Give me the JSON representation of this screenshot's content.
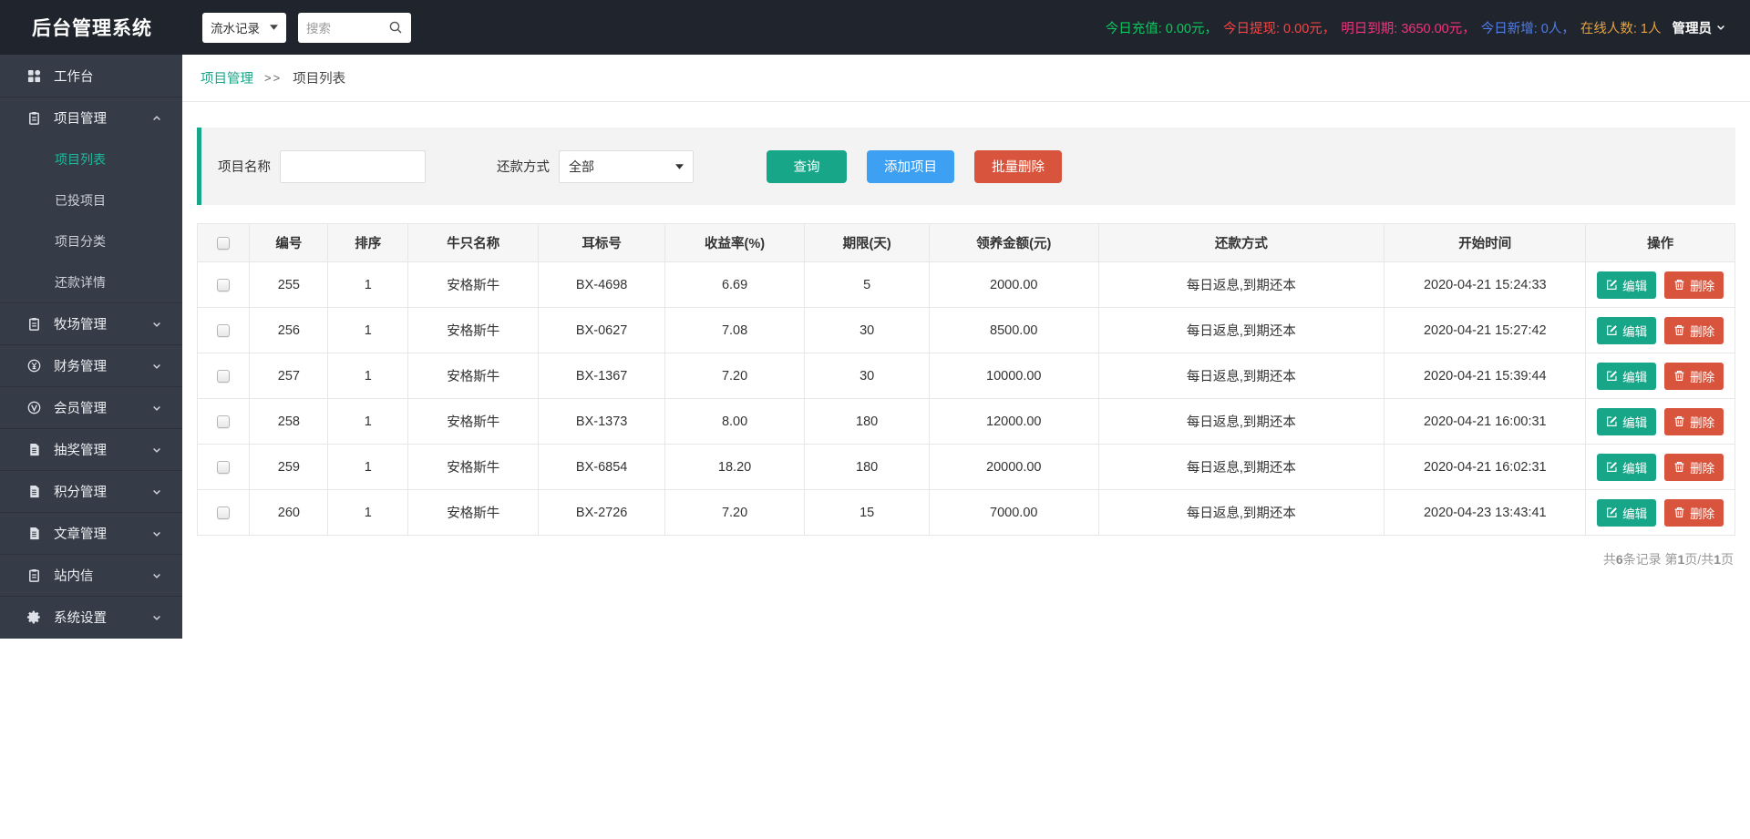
{
  "app": {
    "title": "后台管理系统"
  },
  "colors": {
    "accent_teal": "#18a689",
    "button_blue": "#3da0f2",
    "button_red": "#d9543c",
    "topbar_bg": "#20242d",
    "sidebar_bg": "#353b47",
    "active_menu": "#1abc9c"
  },
  "topbar": {
    "module_select": {
      "value": "流水记录"
    },
    "search": {
      "placeholder": "搜索"
    },
    "stats": [
      {
        "key": "recharge-today",
        "label": "今日充值:",
        "value": "0.00元",
        "sep": "，",
        "color": "#0bc860"
      },
      {
        "key": "withdraw-today",
        "label": "今日提现:",
        "value": "0.00元",
        "sep": "，",
        "color": "#f84343"
      },
      {
        "key": "due-tomorrow",
        "label": "明日到期:",
        "value": "3650.00元",
        "sep": "，",
        "color": "#f5317f"
      },
      {
        "key": "new-today",
        "label": "今日新增:",
        "value": "0人",
        "sep": "，",
        "color": "#4f7de9"
      },
      {
        "key": "online-count",
        "label": "在线人数:",
        "value": "1人",
        "sep": "",
        "color": "#e8a33d"
      }
    ],
    "user": {
      "name": "管理员"
    }
  },
  "sidebar": {
    "items": [
      {
        "label": "工作台",
        "icon": "grid-icon",
        "chevron": "",
        "children": []
      },
      {
        "label": "项目管理",
        "icon": "clipboard-icon",
        "chevron": "up",
        "children": [
          {
            "label": "项目列表",
            "active": true
          },
          {
            "label": "已投项目",
            "active": false
          },
          {
            "label": "项目分类",
            "active": false
          },
          {
            "label": "还款详情",
            "active": false
          }
        ]
      },
      {
        "label": "牧场管理",
        "icon": "clipboard-icon",
        "chevron": "down",
        "children": []
      },
      {
        "label": "财务管理",
        "icon": "yen-circle-icon",
        "chevron": "down",
        "children": []
      },
      {
        "label": "会员管理",
        "icon": "v-circle-icon",
        "chevron": "down",
        "children": []
      },
      {
        "label": "抽奖管理",
        "icon": "document-icon",
        "chevron": "down",
        "children": []
      },
      {
        "label": "积分管理",
        "icon": "document-icon",
        "chevron": "down",
        "children": []
      },
      {
        "label": "文章管理",
        "icon": "document-icon",
        "chevron": "down",
        "children": []
      },
      {
        "label": "站内信",
        "icon": "clipboard-icon",
        "chevron": "down",
        "children": []
      },
      {
        "label": "系统设置",
        "icon": "gear-icon",
        "chevron": "down",
        "children": []
      }
    ]
  },
  "breadcrumb": {
    "parent": "项目管理",
    "separator": ">>",
    "current": "项目列表"
  },
  "filters": {
    "name_label": "项目名称",
    "name_value": "",
    "repay_label": "还款方式",
    "repay_value": "全部",
    "buttons": {
      "search": "查询",
      "add": "添加项目",
      "batch_delete": "批量删除"
    }
  },
  "table": {
    "columns": [
      "编号",
      "排序",
      "牛只名称",
      "耳标号",
      "收益率(%)",
      "期限(天)",
      "领养金额(元)",
      "还款方式",
      "开始时间",
      "操作"
    ],
    "edit_label": "编辑",
    "delete_label": "删除",
    "rows": [
      {
        "id": "255",
        "sort": "1",
        "name": "安格斯牛",
        "tag": "BX-4698",
        "rate": "6.69",
        "days": "5",
        "amount": "2000.00",
        "repay": "每日返息,到期还本",
        "start": "2020-04-21 15:24:33"
      },
      {
        "id": "256",
        "sort": "1",
        "name": "安格斯牛",
        "tag": "BX-0627",
        "rate": "7.08",
        "days": "30",
        "amount": "8500.00",
        "repay": "每日返息,到期还本",
        "start": "2020-04-21 15:27:42"
      },
      {
        "id": "257",
        "sort": "1",
        "name": "安格斯牛",
        "tag": "BX-1367",
        "rate": "7.20",
        "days": "30",
        "amount": "10000.00",
        "repay": "每日返息,到期还本",
        "start": "2020-04-21 15:39:44"
      },
      {
        "id": "258",
        "sort": "1",
        "name": "安格斯牛",
        "tag": "BX-1373",
        "rate": "8.00",
        "days": "180",
        "amount": "12000.00",
        "repay": "每日返息,到期还本",
        "start": "2020-04-21 16:00:31"
      },
      {
        "id": "259",
        "sort": "1",
        "name": "安格斯牛",
        "tag": "BX-6854",
        "rate": "18.20",
        "days": "180",
        "amount": "20000.00",
        "repay": "每日返息,到期还本",
        "start": "2020-04-21 16:02:31"
      },
      {
        "id": "260",
        "sort": "1",
        "name": "安格斯牛",
        "tag": "BX-2726",
        "rate": "7.20",
        "days": "15",
        "amount": "7000.00",
        "repay": "每日返息,到期还本",
        "start": "2020-04-23 13:43:41"
      }
    ]
  },
  "pagination": {
    "parts": [
      {
        "t": "共"
      },
      {
        "t": "6",
        "b": true
      },
      {
        "t": "条记录 第"
      },
      {
        "t": "1",
        "b": true
      },
      {
        "t": "页/共"
      },
      {
        "t": "1",
        "b": true
      },
      {
        "t": "页"
      }
    ]
  }
}
